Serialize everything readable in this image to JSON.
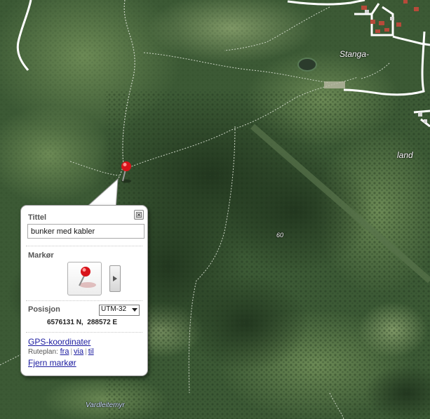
{
  "map": {
    "place_labels": [
      {
        "id": "stanga",
        "text": "Stanga-"
      },
      {
        "id": "land",
        "text": "land"
      },
      {
        "id": "elev60",
        "text": "60"
      },
      {
        "id": "vardleitemyr",
        "text": "Vardleitemyr"
      }
    ],
    "marker_icon": "red-pushpin-icon"
  },
  "popup": {
    "title_label": "Tittel",
    "title_value": "bunker med kabler",
    "marker_label": "Markør",
    "position_label": "Posisjon",
    "coord_system": "UTM-32",
    "northing": "6576131 N,",
    "easting": "288572 E",
    "gps_link": "GPS-koordinater",
    "route_label": "Ruteplan:",
    "route_from": "fra",
    "route_via": "via",
    "route_to": "til",
    "remove_marker": "Fjern markør",
    "close_icon": "close-icon"
  },
  "colors": {
    "link": "#1a1a9f",
    "pin": "#d8131a",
    "forest": "#2f4a2a",
    "field": "#5f7f4c"
  }
}
